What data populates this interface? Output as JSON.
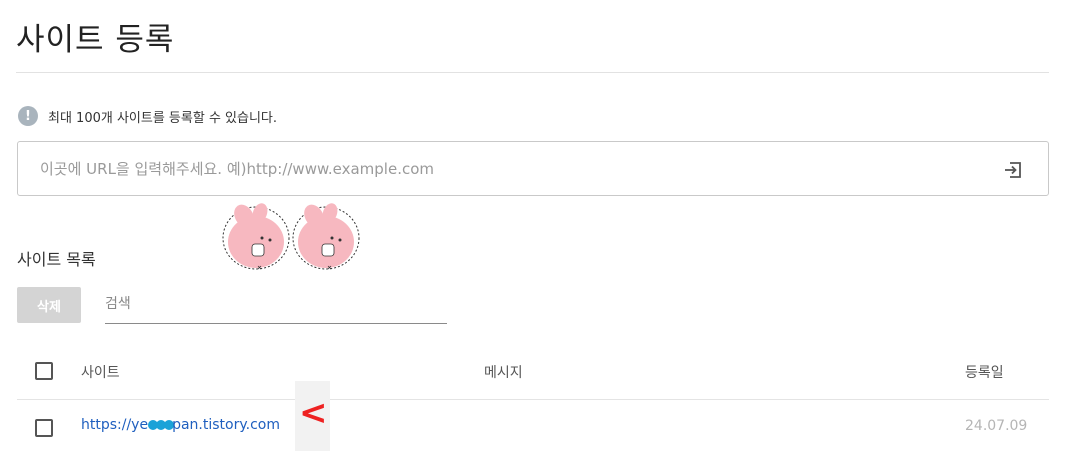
{
  "page": {
    "title": "사이트 등록"
  },
  "notice": {
    "icon": "info-icon",
    "icon_glyph": "!",
    "text": "최대 100개 사이트를 등록할 수 있습니다."
  },
  "url_input": {
    "placeholder": "이곳에 URL을 입력해주세요. 예)http://www.example.com",
    "value": "",
    "submit_icon": "enter-icon"
  },
  "site_list": {
    "title": "사이트 목록",
    "delete_label": "삭제",
    "search_placeholder": "검색",
    "columns": {
      "site": "사이트",
      "message": "메시지",
      "registered": "등록일"
    },
    "rows": [
      {
        "url_prefix": "https://ye",
        "url_suffix": "pan.tistory.com",
        "message": "",
        "registered": "24.07.09"
      }
    ]
  },
  "annotation": {
    "arrow_mark": "<",
    "arrow_color": "#ee2222"
  },
  "colors": {
    "link": "#1f5fbf",
    "redaction": "#1aa2d8",
    "delete_button": "#d4d4d4",
    "notice_icon": "#a9b4bd"
  }
}
